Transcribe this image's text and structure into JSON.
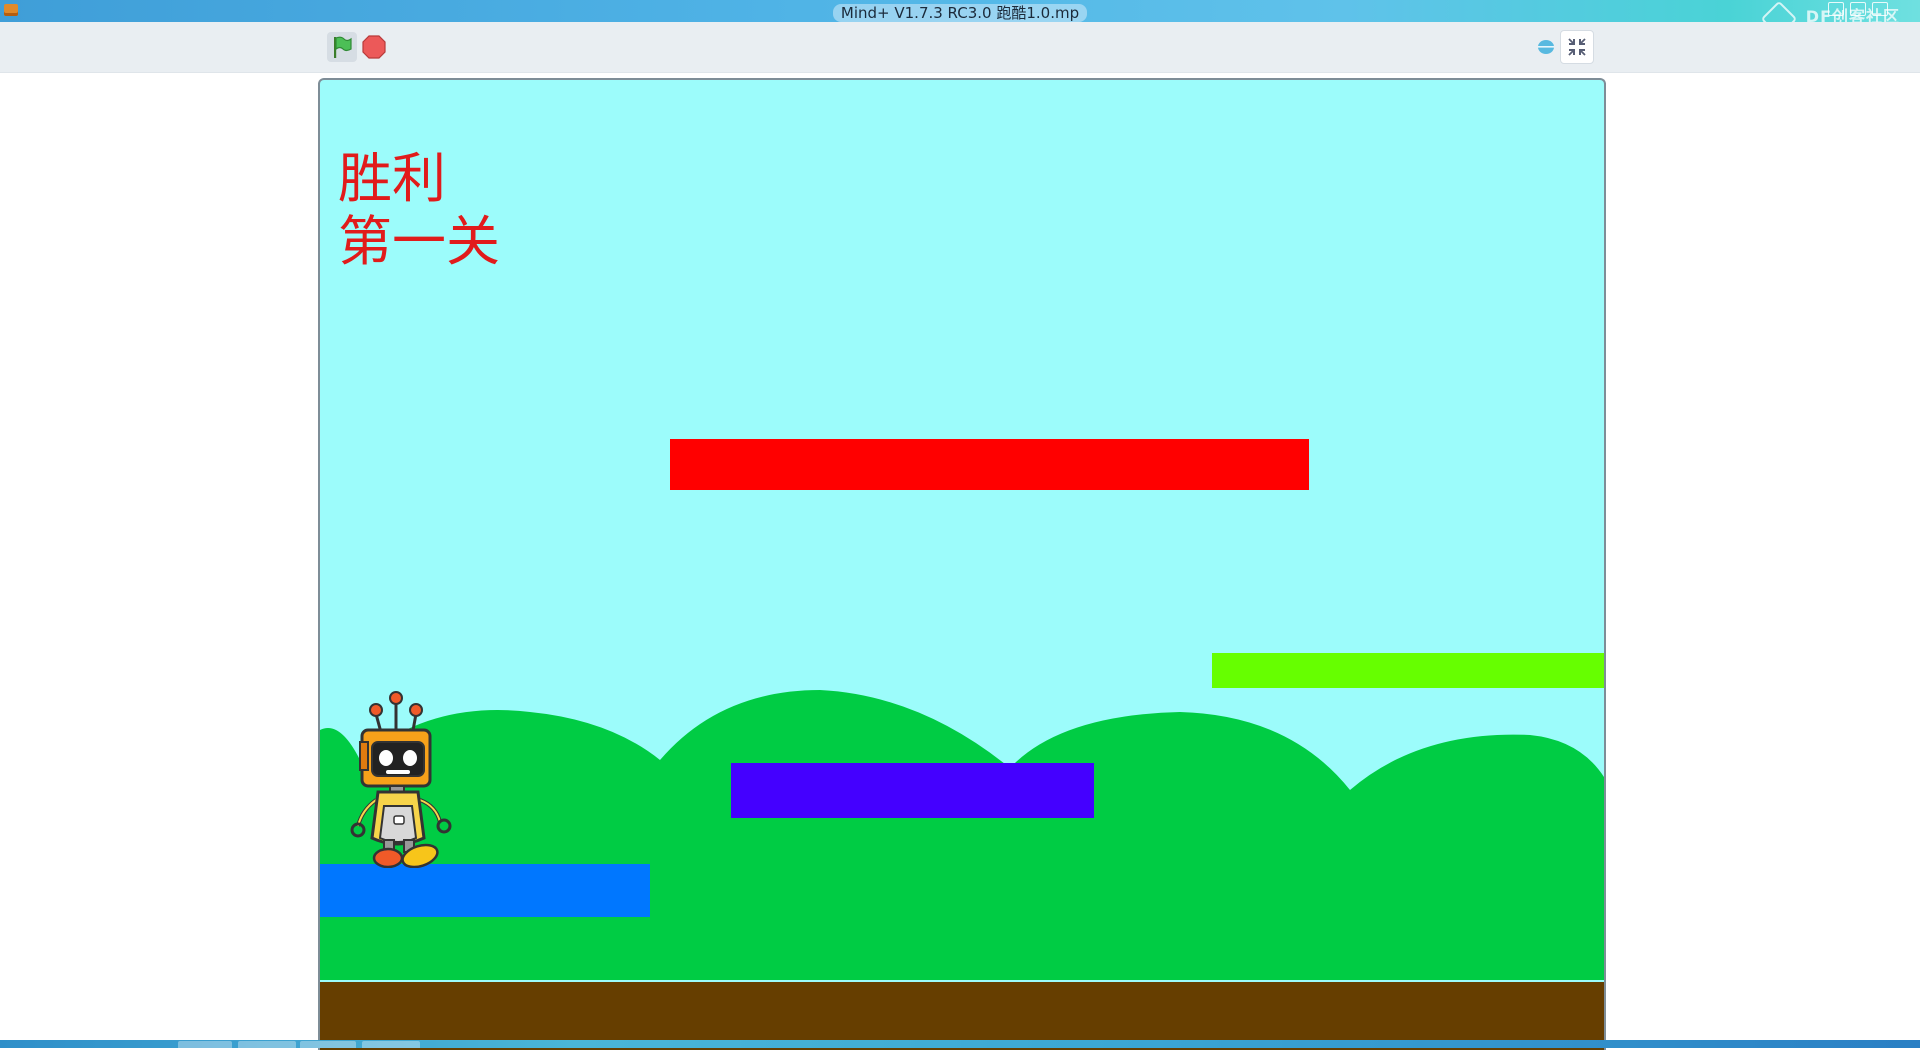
{
  "window": {
    "title": "Mind+ V1.7.3 RC3.0   跑酷1.0.mp",
    "watermark": "DF创客社区"
  },
  "toolbar": {
    "green_flag_icon": "green-flag-icon",
    "stop_icon": "stop-sign-icon",
    "stage_size_icon": "small-stage-icon",
    "fullscreen_exit_icon": "exit-fullscreen-icon"
  },
  "stage": {
    "status_text": "胜利",
    "level_text": "第一关",
    "colors": {
      "sky": "#9cfcfb",
      "hills": "#00cc44",
      "ground": "#663e00",
      "text": "#e11b1b",
      "red_platform": "#ff0000",
      "green_platform": "#66ff00",
      "purple_platform": "#4400ff",
      "blue_platform": "#0077ff"
    },
    "sprite": "robot-sprite"
  }
}
